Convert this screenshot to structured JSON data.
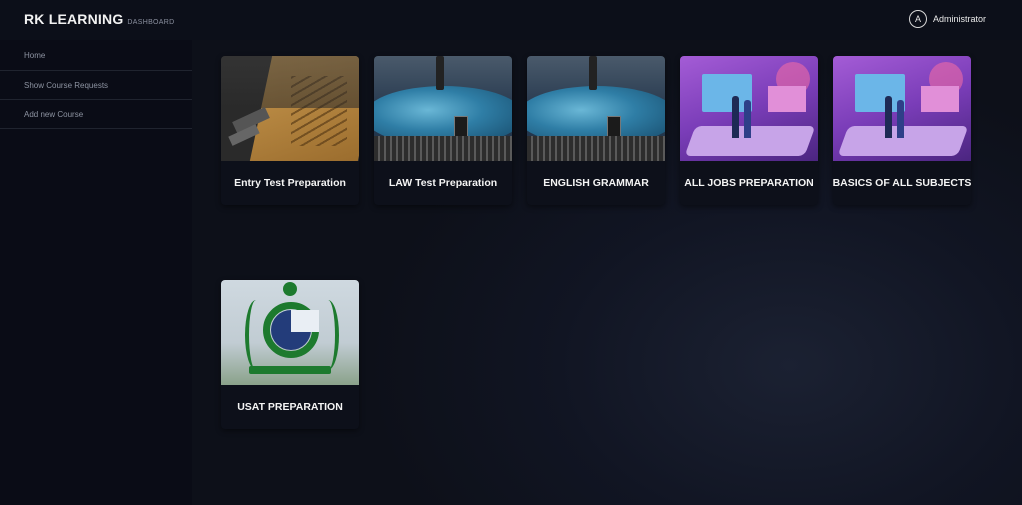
{
  "brand": {
    "title": "RK LEARNING",
    "subtitle": "DASHBOARD"
  },
  "user": {
    "avatar_letter": "A",
    "name": "Administrator"
  },
  "sidebar": {
    "items": [
      {
        "label": "Home"
      },
      {
        "label": "Show Course Requests"
      },
      {
        "label": "Add new Course"
      }
    ]
  },
  "courses": [
    {
      "title": "Entry Test Preparation",
      "image": "leather-pad-image"
    },
    {
      "title": "LAW Test Preparation",
      "image": "car-hood-image"
    },
    {
      "title": "ENGLISH GRAMMAR",
      "image": "car-hood-image"
    },
    {
      "title": "ALL JOBS PREPARATION",
      "image": "office-illustration-image"
    },
    {
      "title": "BASICS OF ALL SUBJECTS",
      "image": "office-illustration-image"
    },
    {
      "title": "USAT PREPARATION",
      "image": "hec-logo-image"
    }
  ]
}
